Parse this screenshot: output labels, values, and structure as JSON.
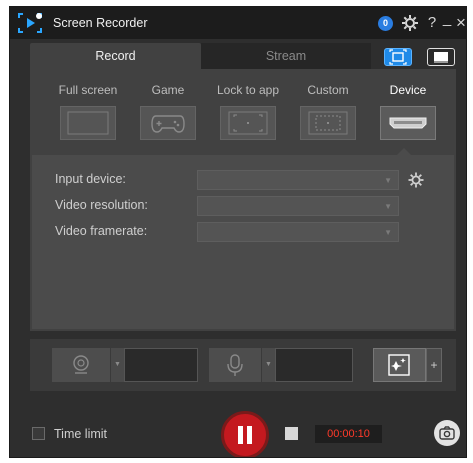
{
  "app": {
    "title": "Screen Recorder",
    "notification_count": "0"
  },
  "titlebar": {
    "help_label": "?",
    "minimize_label": "_",
    "close_label": "×"
  },
  "tabs": [
    {
      "label": "Record",
      "active": true
    },
    {
      "label": "Stream",
      "active": false
    }
  ],
  "modes": [
    {
      "label": "Full screen",
      "icon": "monitor-icon"
    },
    {
      "label": "Game",
      "icon": "gamepad-icon"
    },
    {
      "label": "Lock to app",
      "icon": "lock-to-app-icon"
    },
    {
      "label": "Custom",
      "icon": "custom-area-icon"
    },
    {
      "label": "Device",
      "icon": "hdmi-device-icon",
      "active": true
    }
  ],
  "device_settings": {
    "input_device": {
      "label": "Input device:",
      "value": ""
    },
    "video_resolution": {
      "label": "Video resolution:",
      "value": ""
    },
    "video_framerate": {
      "label": "Video framerate:",
      "value": ""
    }
  },
  "sources": {
    "webcam_icon": "webcam-icon",
    "mic_icon": "microphone-icon",
    "effects_icon": "sparkle-effects-icon",
    "effects_add_label": "+"
  },
  "bottom": {
    "time_limit_label": "Time limit",
    "time_limit_checked": false,
    "timer": "00:00:10",
    "record_state": "recording"
  },
  "colors": {
    "accent": "#1f8ae8",
    "record": "#c4191f",
    "timer_text": "#ff3a2a"
  }
}
